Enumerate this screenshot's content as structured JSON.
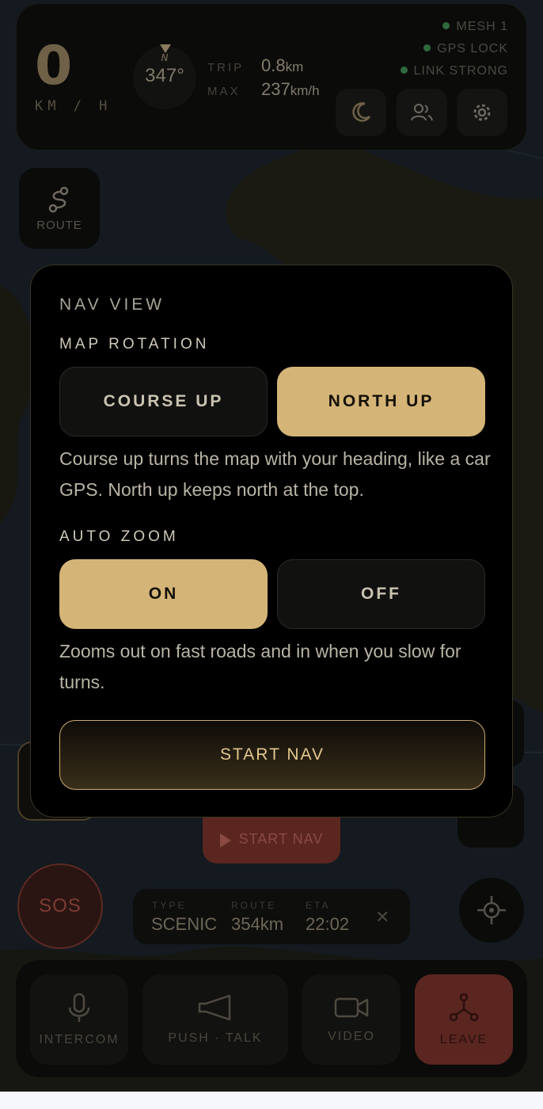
{
  "hud": {
    "speed": "0",
    "speed_unit": "KM / H",
    "compass_label": "N",
    "heading": "347°",
    "trip_label": "TRIP",
    "trip_value": "0.8",
    "trip_unit": "km",
    "max_label": "MAX",
    "max_value": "237",
    "max_unit": "km/h",
    "status": [
      "MESH 1",
      "GPS LOCK",
      "LINK STRONG"
    ],
    "buttons": [
      "moon-icon",
      "group-icon",
      "gear-icon"
    ]
  },
  "route_button": {
    "label": "ROUTE"
  },
  "background_start_nav": "START NAV",
  "sos": "SOS",
  "trip_card": {
    "type_label": "TYPE",
    "type_value": "SCENIC",
    "route_label": "ROUTE",
    "route_value": "354km",
    "eta_label": "ETA",
    "eta_value": "22:02",
    "close": "✕"
  },
  "dock": {
    "intercom": "INTERCOM",
    "push_talk": "PUSH · TALK",
    "video": "VIDEO",
    "leave": "LEAVE"
  },
  "modal": {
    "title": "NAV VIEW",
    "rotation": {
      "label": "MAP ROTATION",
      "options": [
        "COURSE UP",
        "NORTH UP"
      ],
      "selected": "NORTH UP",
      "description": "Course up turns the map with your heading, like a car GPS. North up keeps north at the top."
    },
    "auto_zoom": {
      "label": "AUTO ZOOM",
      "options": [
        "ON",
        "OFF"
      ],
      "selected": "ON",
      "description": "Zooms out on fast roads and in when you slow for turns."
    },
    "start_button": "START NAV"
  },
  "colors": {
    "accent": "#d4b577",
    "danger": "#5b2620",
    "status_green": "#2f6a3e"
  }
}
